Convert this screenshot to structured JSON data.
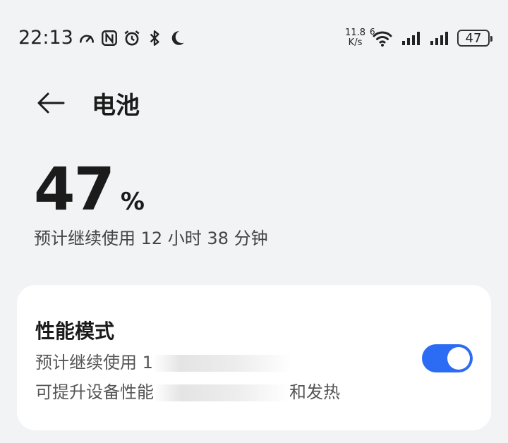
{
  "status_bar": {
    "time": "22:13",
    "net_speed_value": "11.8",
    "net_speed_unit": "K/s",
    "wifi_gen": "6",
    "battery_level": "47",
    "icons_left": [
      "speedometer-icon",
      "nfc-icon",
      "alarm-icon",
      "bluetooth-icon",
      "moon-icon"
    ],
    "icons_right": [
      "wifi-icon",
      "signal-icon",
      "signal-icon",
      "battery-icon"
    ]
  },
  "header": {
    "back_icon": "arrow-left-icon",
    "title": "电池"
  },
  "battery": {
    "percent": "47",
    "percent_sign": "%",
    "estimate": "预计继续使用 12 小时 38 分钟"
  },
  "performance_card": {
    "title": "性能模式",
    "line1_prefix": "预计继续使用 1",
    "line2_prefix": "可提升设备性能",
    "line2_suffix": "和发热",
    "toggle_on": true,
    "toggle_color": "#2c6cf5"
  }
}
